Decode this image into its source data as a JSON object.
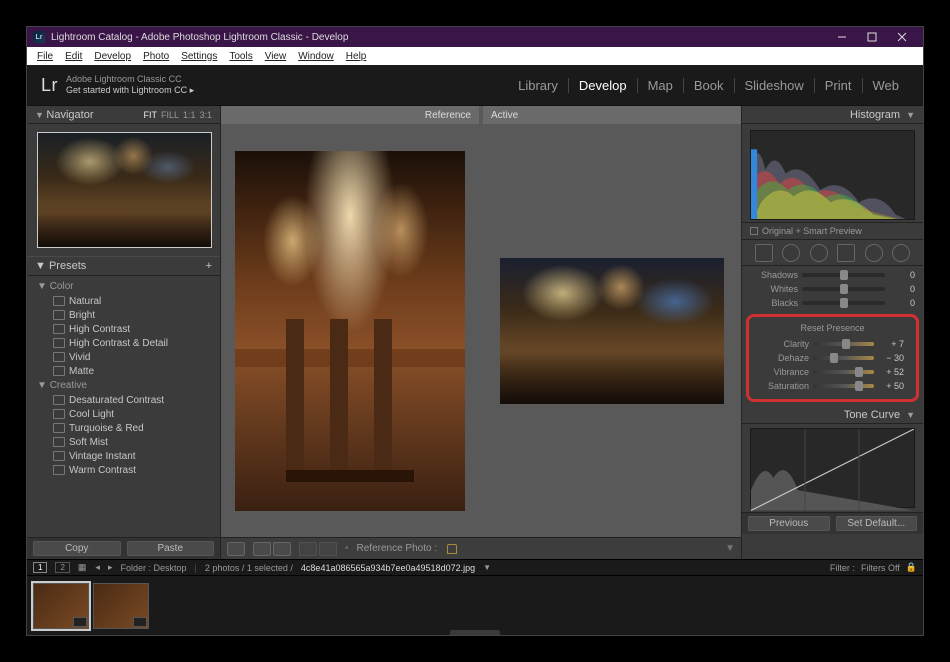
{
  "window": {
    "title": "Lightroom Catalog - Adobe Photoshop Lightroom Classic - Develop"
  },
  "menu": [
    "File",
    "Edit",
    "Develop",
    "Photo",
    "Settings",
    "Tools",
    "View",
    "Window",
    "Help"
  ],
  "identity": {
    "logo": "Lr",
    "line1": "Adobe Lightroom Classic CC",
    "line2": "Get started with Lightroom CC  ▸"
  },
  "modules": [
    "Library",
    "Develop",
    "Map",
    "Book",
    "Slideshow",
    "Print",
    "Web"
  ],
  "modules_active": "Develop",
  "navigator": {
    "title": "Navigator",
    "zoom": [
      "FIT",
      "FILL",
      "1:1",
      "3:1"
    ],
    "zoom_active": "FIT"
  },
  "presets": {
    "title": "Presets",
    "groups": [
      {
        "name": "Color",
        "items": [
          "Natural",
          "Bright",
          "High Contrast",
          "High Contrast & Detail",
          "Vivid",
          "Matte"
        ]
      },
      {
        "name": "Creative",
        "items": [
          "Desaturated Contrast",
          "Cool Light",
          "Turquoise & Red",
          "Soft Mist",
          "Vintage Instant",
          "Warm Contrast"
        ]
      }
    ]
  },
  "copy_paste": {
    "copy": "Copy",
    "paste": "Paste"
  },
  "compare": {
    "reference_label": "Reference",
    "active_label": "Active",
    "toolbar_label": "Reference Photo :"
  },
  "rightpanel": {
    "histogram": "Histogram",
    "original_smart": "Original + Smart Preview",
    "tone_sliders": [
      {
        "label": "Shadows",
        "value": "0",
        "pos": 50
      },
      {
        "label": "Whites",
        "value": "0",
        "pos": 50
      },
      {
        "label": "Blacks",
        "value": "0",
        "pos": 50
      }
    ],
    "presence_title": "Reset Presence",
    "presence": [
      {
        "label": "Clarity",
        "value": "+ 7",
        "pos": 54
      },
      {
        "label": "Dehaze",
        "value": "− 30",
        "pos": 35
      },
      {
        "label": "Vibrance",
        "value": "+ 52",
        "pos": 76
      },
      {
        "label": "Saturation",
        "value": "+ 50",
        "pos": 75
      }
    ],
    "tonecurve": "Tone Curve",
    "previous": "Previous",
    "set_default": "Set Default..."
  },
  "filmstrip": {
    "pages": [
      "1",
      "2"
    ],
    "folder_label": "Folder : Desktop",
    "count": "2 photos / 1 selected /",
    "filename": "4c8e41a086565a934b7ee0a49518d072.jpg",
    "filter_label": "Filter :",
    "filter_value": "Filters Off"
  }
}
